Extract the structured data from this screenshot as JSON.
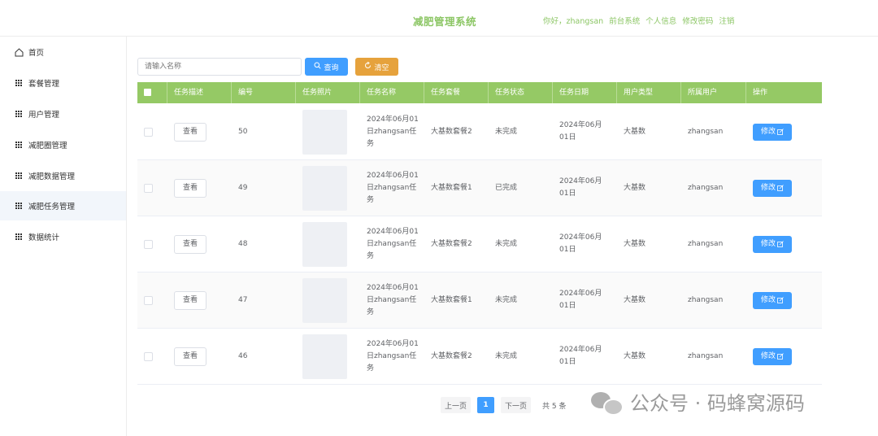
{
  "header": {
    "title": "减肥管理系统",
    "greeting": "你好，zhangsan",
    "links": [
      "前台系统",
      "个人信息",
      "修改密码",
      "注销"
    ]
  },
  "sidebar": {
    "items": [
      {
        "label": "首页",
        "icon": "home-icon"
      },
      {
        "label": "套餐管理",
        "icon": "grid-icon"
      },
      {
        "label": "用户管理",
        "icon": "grid-icon"
      },
      {
        "label": "减肥圈管理",
        "icon": "grid-icon"
      },
      {
        "label": "减肥数据管理",
        "icon": "grid-icon"
      },
      {
        "label": "减肥任务管理",
        "icon": "grid-icon",
        "active": true
      },
      {
        "label": "数据统计",
        "icon": "grid-icon"
      }
    ]
  },
  "search": {
    "placeholder": "请输入名称",
    "query_label": "查询",
    "clear_label": "清空"
  },
  "table": {
    "headers": [
      "任务描述",
      "编号",
      "任务照片",
      "任务名称",
      "任务套餐",
      "任务状态",
      "任务日期",
      "用户类型",
      "所属用户",
      "操作"
    ],
    "view_label": "查看",
    "edit_label": "修改",
    "rows": [
      {
        "id": "50",
        "name": "2024年06月01日zhangsan任务",
        "package": "大基数套餐2",
        "status": "未完成",
        "date": "2024年06月01日",
        "user_type": "大基数",
        "user": "zhangsan"
      },
      {
        "id": "49",
        "name": "2024年06月01日zhangsan任务",
        "package": "大基数套餐1",
        "status": "已完成",
        "date": "2024年06月01日",
        "user_type": "大基数",
        "user": "zhangsan"
      },
      {
        "id": "48",
        "name": "2024年06月01日zhangsan任务",
        "package": "大基数套餐2",
        "status": "未完成",
        "date": "2024年06月01日",
        "user_type": "大基数",
        "user": "zhangsan"
      },
      {
        "id": "47",
        "name": "2024年06月01日zhangsan任务",
        "package": "大基数套餐1",
        "status": "未完成",
        "date": "2024年06月01日",
        "user_type": "大基数",
        "user": "zhangsan"
      },
      {
        "id": "46",
        "name": "2024年06月01日zhangsan任务",
        "package": "大基数套餐2",
        "status": "未完成",
        "date": "2024年06月01日",
        "user_type": "大基数",
        "user": "zhangsan"
      }
    ]
  },
  "pagination": {
    "prev_label": "上一页",
    "current_page": "1",
    "next_label": "下一页",
    "total_label": "共 5 条"
  },
  "watermark": {
    "text": "公众号 · 码蜂窝源码"
  },
  "colors": {
    "accent_green": "#8cc665",
    "header_green": "#95c965",
    "primary_blue": "#409eff",
    "warning_orange": "#e6a23c"
  }
}
